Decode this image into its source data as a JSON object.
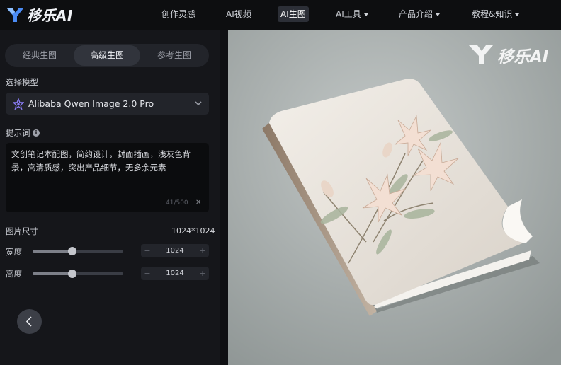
{
  "brand": {
    "name": "移乐AI",
    "logo_text": "移乐AI"
  },
  "nav": {
    "items": [
      {
        "label": "创作灵感",
        "has_caret": false
      },
      {
        "label": "AI视频",
        "has_caret": false
      },
      {
        "label": "AI生图",
        "has_caret": false,
        "active": true
      },
      {
        "label": "AI工具",
        "has_caret": true
      },
      {
        "label": "产品介绍",
        "has_caret": true
      },
      {
        "label": "教程&知识",
        "has_caret": true
      }
    ]
  },
  "tabs": [
    {
      "label": "经典生图",
      "active": false
    },
    {
      "label": "高级生图",
      "active": true
    },
    {
      "label": "参考生图",
      "active": false
    }
  ],
  "model": {
    "label": "选择模型",
    "selected": "Alibaba Qwen Image 2.0 Pro"
  },
  "prompt": {
    "label": "提示词",
    "text": "文创笔记本配图，简约设计，封面插画，浅灰色背景，高清质感，突出产品细节，无多余元素",
    "counter": "41/500"
  },
  "image_size": {
    "label": "图片尺寸",
    "value": "1024*1024",
    "width": {
      "label": "宽度",
      "value": "1024",
      "slider_fraction": 0.43
    },
    "height": {
      "label": "高度",
      "value": "1024",
      "slider_fraction": 0.43
    }
  },
  "colors": {
    "accent": "#6c4cff",
    "logo_blue": "#4b8cf5",
    "background": "#111214"
  },
  "preview": {
    "watermark": "移乐AI"
  }
}
